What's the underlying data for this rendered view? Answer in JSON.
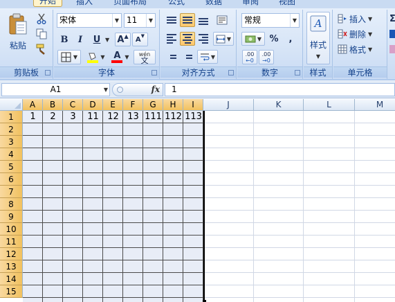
{
  "ribbon": {
    "tabs": [
      "开始",
      "插入",
      "页面布局",
      "公式",
      "数据",
      "审阅",
      "视图"
    ],
    "clipboard": {
      "label": "剪贴板",
      "paste": "粘贴"
    },
    "font": {
      "label": "字体",
      "name": "宋体",
      "size": "11",
      "bold": "B",
      "italic": "I",
      "underline": "U",
      "grow": "A",
      "shrink": "A",
      "wen": "wén",
      "wen_char": "文"
    },
    "alignment": {
      "label": "对齐方式"
    },
    "number": {
      "label": "数字",
      "format": "常规",
      "percent": "%",
      "comma": ",",
      "inc_decimal": ".00",
      "dec_decimal": ".00"
    },
    "styles": {
      "label": "样式",
      "title": "样式"
    },
    "cells": {
      "label": "单元格",
      "insert": "插入",
      "delete": "删除",
      "format": "格式"
    },
    "editing": {
      "sigma": "Σ"
    }
  },
  "formula_bar": {
    "name_box": "A1",
    "fx": "fx",
    "content": "1"
  },
  "sheet": {
    "columns": [
      "A",
      "B",
      "C",
      "D",
      "E",
      "F",
      "G",
      "H",
      "I",
      "J",
      "K",
      "L",
      "M"
    ],
    "rows": [
      "1",
      "2",
      "3",
      "4",
      "5",
      "6",
      "7",
      "8",
      "9",
      "10",
      "11",
      "12",
      "13",
      "14",
      "15"
    ],
    "row1_values": [
      "1",
      "2",
      "3",
      "11",
      "12",
      "13",
      "111",
      "112",
      "113"
    ]
  }
}
